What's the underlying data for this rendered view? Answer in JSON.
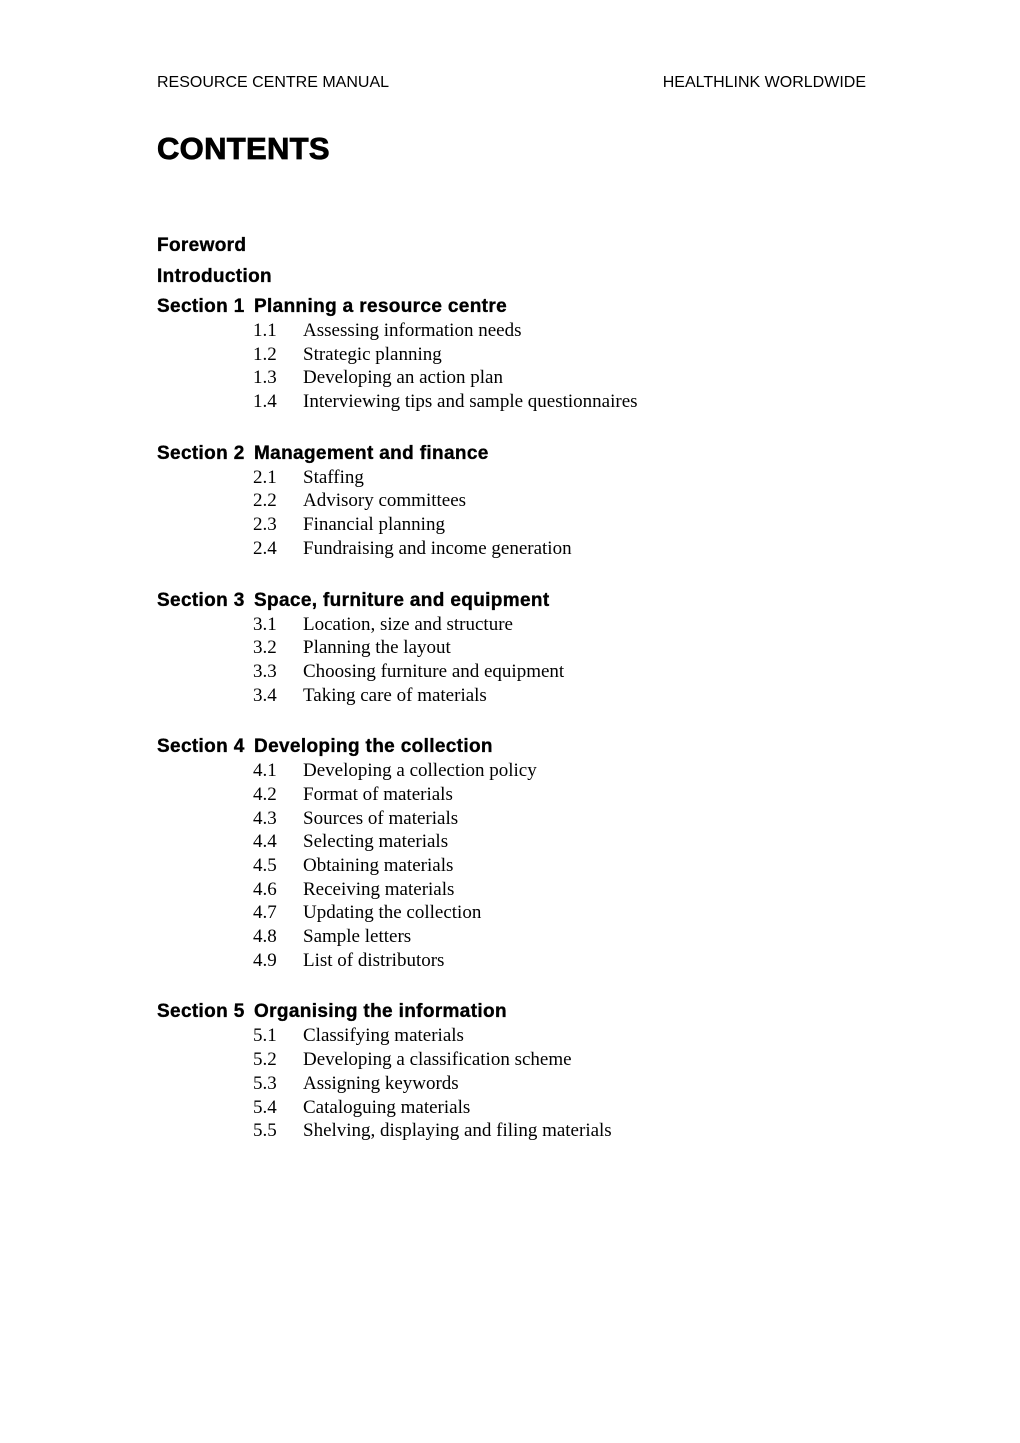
{
  "header": {
    "left": "RESOURCE CENTRE MANUAL",
    "right": "HEALTHLINK WORLDWIDE"
  },
  "title": "CONTENTS",
  "front_matter": [
    "Foreword",
    "Introduction"
  ],
  "sections": [
    {
      "label": "Section 1",
      "title": "Planning a resource centre",
      "items": [
        {
          "num": "1.1",
          "title": "Assessing information needs"
        },
        {
          "num": "1.2",
          "title": "Strategic planning"
        },
        {
          "num": "1.3",
          "title": "Developing an action plan"
        },
        {
          "num": "1.4",
          "title": "Interviewing tips and sample questionnaires"
        }
      ]
    },
    {
      "label": "Section 2",
      "title": "Management and finance",
      "items": [
        {
          "num": "2.1",
          "title": "Staffing"
        },
        {
          "num": "2.2",
          "title": "Advisory committees"
        },
        {
          "num": "2.3",
          "title": "Financial planning"
        },
        {
          "num": "2.4",
          "title": "Fundraising and income generation"
        }
      ]
    },
    {
      "label": "Section 3",
      "title": "Space, furniture and equipment",
      "items": [
        {
          "num": "3.1",
          "title": "Location, size and structure"
        },
        {
          "num": "3.2",
          "title": "Planning the layout"
        },
        {
          "num": "3.3",
          "title": "Choosing furniture and equipment"
        },
        {
          "num": "3.4",
          "title": "Taking care of materials"
        }
      ]
    },
    {
      "label": "Section 4",
      "title": "Developing the collection",
      "items": [
        {
          "num": "4.1",
          "title": "Developing a collection policy"
        },
        {
          "num": "4.2",
          "title": "Format of materials"
        },
        {
          "num": "4.3",
          "title": "Sources of materials"
        },
        {
          "num": "4.4",
          "title": "Selecting materials"
        },
        {
          "num": "4.5",
          "title": "Obtaining materials"
        },
        {
          "num": "4.6",
          "title": "Receiving materials"
        },
        {
          "num": "4.7",
          "title": "Updating the collection"
        },
        {
          "num": "4.8",
          "title": "Sample letters"
        },
        {
          "num": "4.9",
          "title": "List of distributors"
        }
      ]
    },
    {
      "label": "Section 5",
      "title": "Organising the information",
      "items": [
        {
          "num": "5.1",
          "title": "Classifying materials"
        },
        {
          "num": "5.2",
          "title": "Developing a classification scheme"
        },
        {
          "num": "5.3",
          "title": "Assigning keywords"
        },
        {
          "num": "5.4",
          "title": "Cataloguing materials"
        },
        {
          "num": "5.5",
          "title": "Shelving, displaying and filing materials"
        }
      ]
    }
  ]
}
